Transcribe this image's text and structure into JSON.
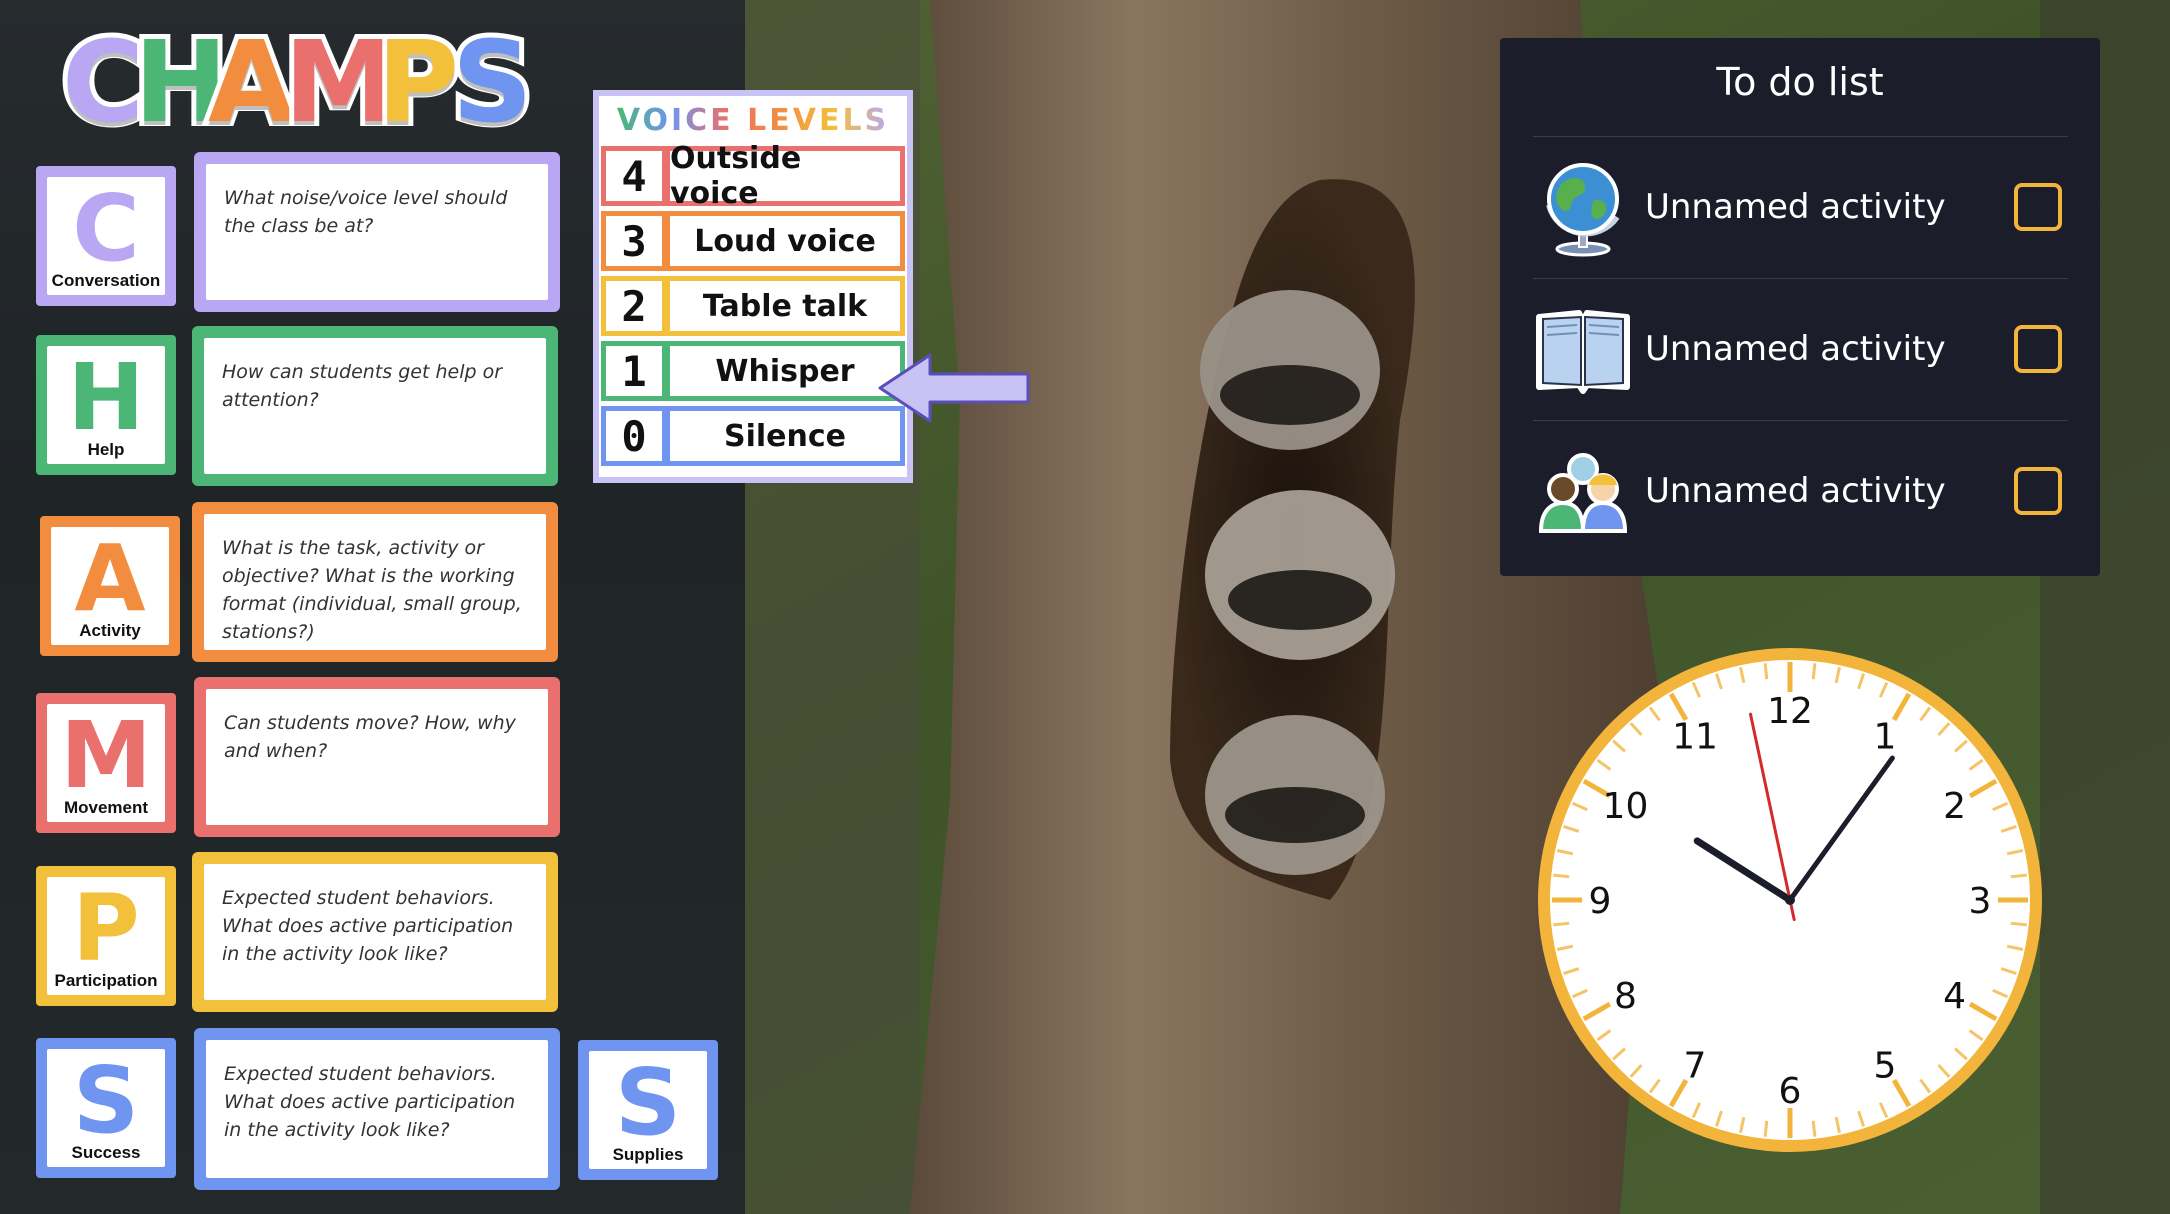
{
  "title": {
    "letters": [
      {
        "char": "C",
        "color": "#b9a7f3"
      },
      {
        "char": "H",
        "color": "#4bb675"
      },
      {
        "char": "A",
        "color": "#f28d3f"
      },
      {
        "char": "M",
        "color": "#e9706c"
      },
      {
        "char": "P",
        "color": "#f2c03b"
      },
      {
        "char": "S",
        "color": "#6f95f0"
      }
    ]
  },
  "champs": [
    {
      "letter": "C",
      "label": "Conversation",
      "question": "What noise/voice level should the class be at?",
      "color": "#b9a7f3"
    },
    {
      "letter": "H",
      "label": "Help",
      "question": "How can students get help or attention?",
      "color": "#4bb675"
    },
    {
      "letter": "A",
      "label": "Activity",
      "question": "What is the task, activity or objective? What is the working format (individual, small group, stations?)",
      "color": "#f28d3f"
    },
    {
      "letter": "M",
      "label": "Movement",
      "question": "Can students move? How, why and when?",
      "color": "#e9706c"
    },
    {
      "letter": "P",
      "label": "Participation",
      "question": "Expected student behaviors. What does active participation in the activity look like?",
      "color": "#f2c03b"
    },
    {
      "letter": "S",
      "label": "Success",
      "question": "Expected student behaviors. What does active participation in the activity look like?",
      "color": "#6f95f0"
    }
  ],
  "supplies": {
    "letter": "S",
    "label": "Supplies"
  },
  "voice_levels": {
    "title": "VOICE LEVELS",
    "levels": [
      {
        "num": "4",
        "label": "Outside voice",
        "color": "#e9706c"
      },
      {
        "num": "3",
        "label": "Loud voice",
        "color": "#f28d3f"
      },
      {
        "num": "2",
        "label": "Table talk",
        "color": "#f2c03b"
      },
      {
        "num": "1",
        "label": "Whisper",
        "color": "#4bb675"
      },
      {
        "num": "0",
        "label": "Silence",
        "color": "#6f95f0"
      }
    ],
    "selected_level": "1"
  },
  "todo": {
    "title": "To do list",
    "items": [
      {
        "icon": "globe-icon",
        "label": "Unnamed activity",
        "checked": false
      },
      {
        "icon": "book-icon",
        "label": "Unnamed activity",
        "checked": false
      },
      {
        "icon": "group-icon",
        "label": "Unnamed activity",
        "checked": false
      }
    ]
  },
  "clock": {
    "numbers": [
      "12",
      "1",
      "2",
      "3",
      "4",
      "5",
      "6",
      "7",
      "8",
      "9",
      "10",
      "11"
    ],
    "time": {
      "hour": 10,
      "minute": 5,
      "second": 58
    }
  },
  "colors": {
    "todo_bg": "#1b1d2b",
    "checkbox": "#f2b43a",
    "clock_rim": "#f2b43a",
    "second_hand": "#d42a2a",
    "arrow": "#c9c2f5"
  }
}
